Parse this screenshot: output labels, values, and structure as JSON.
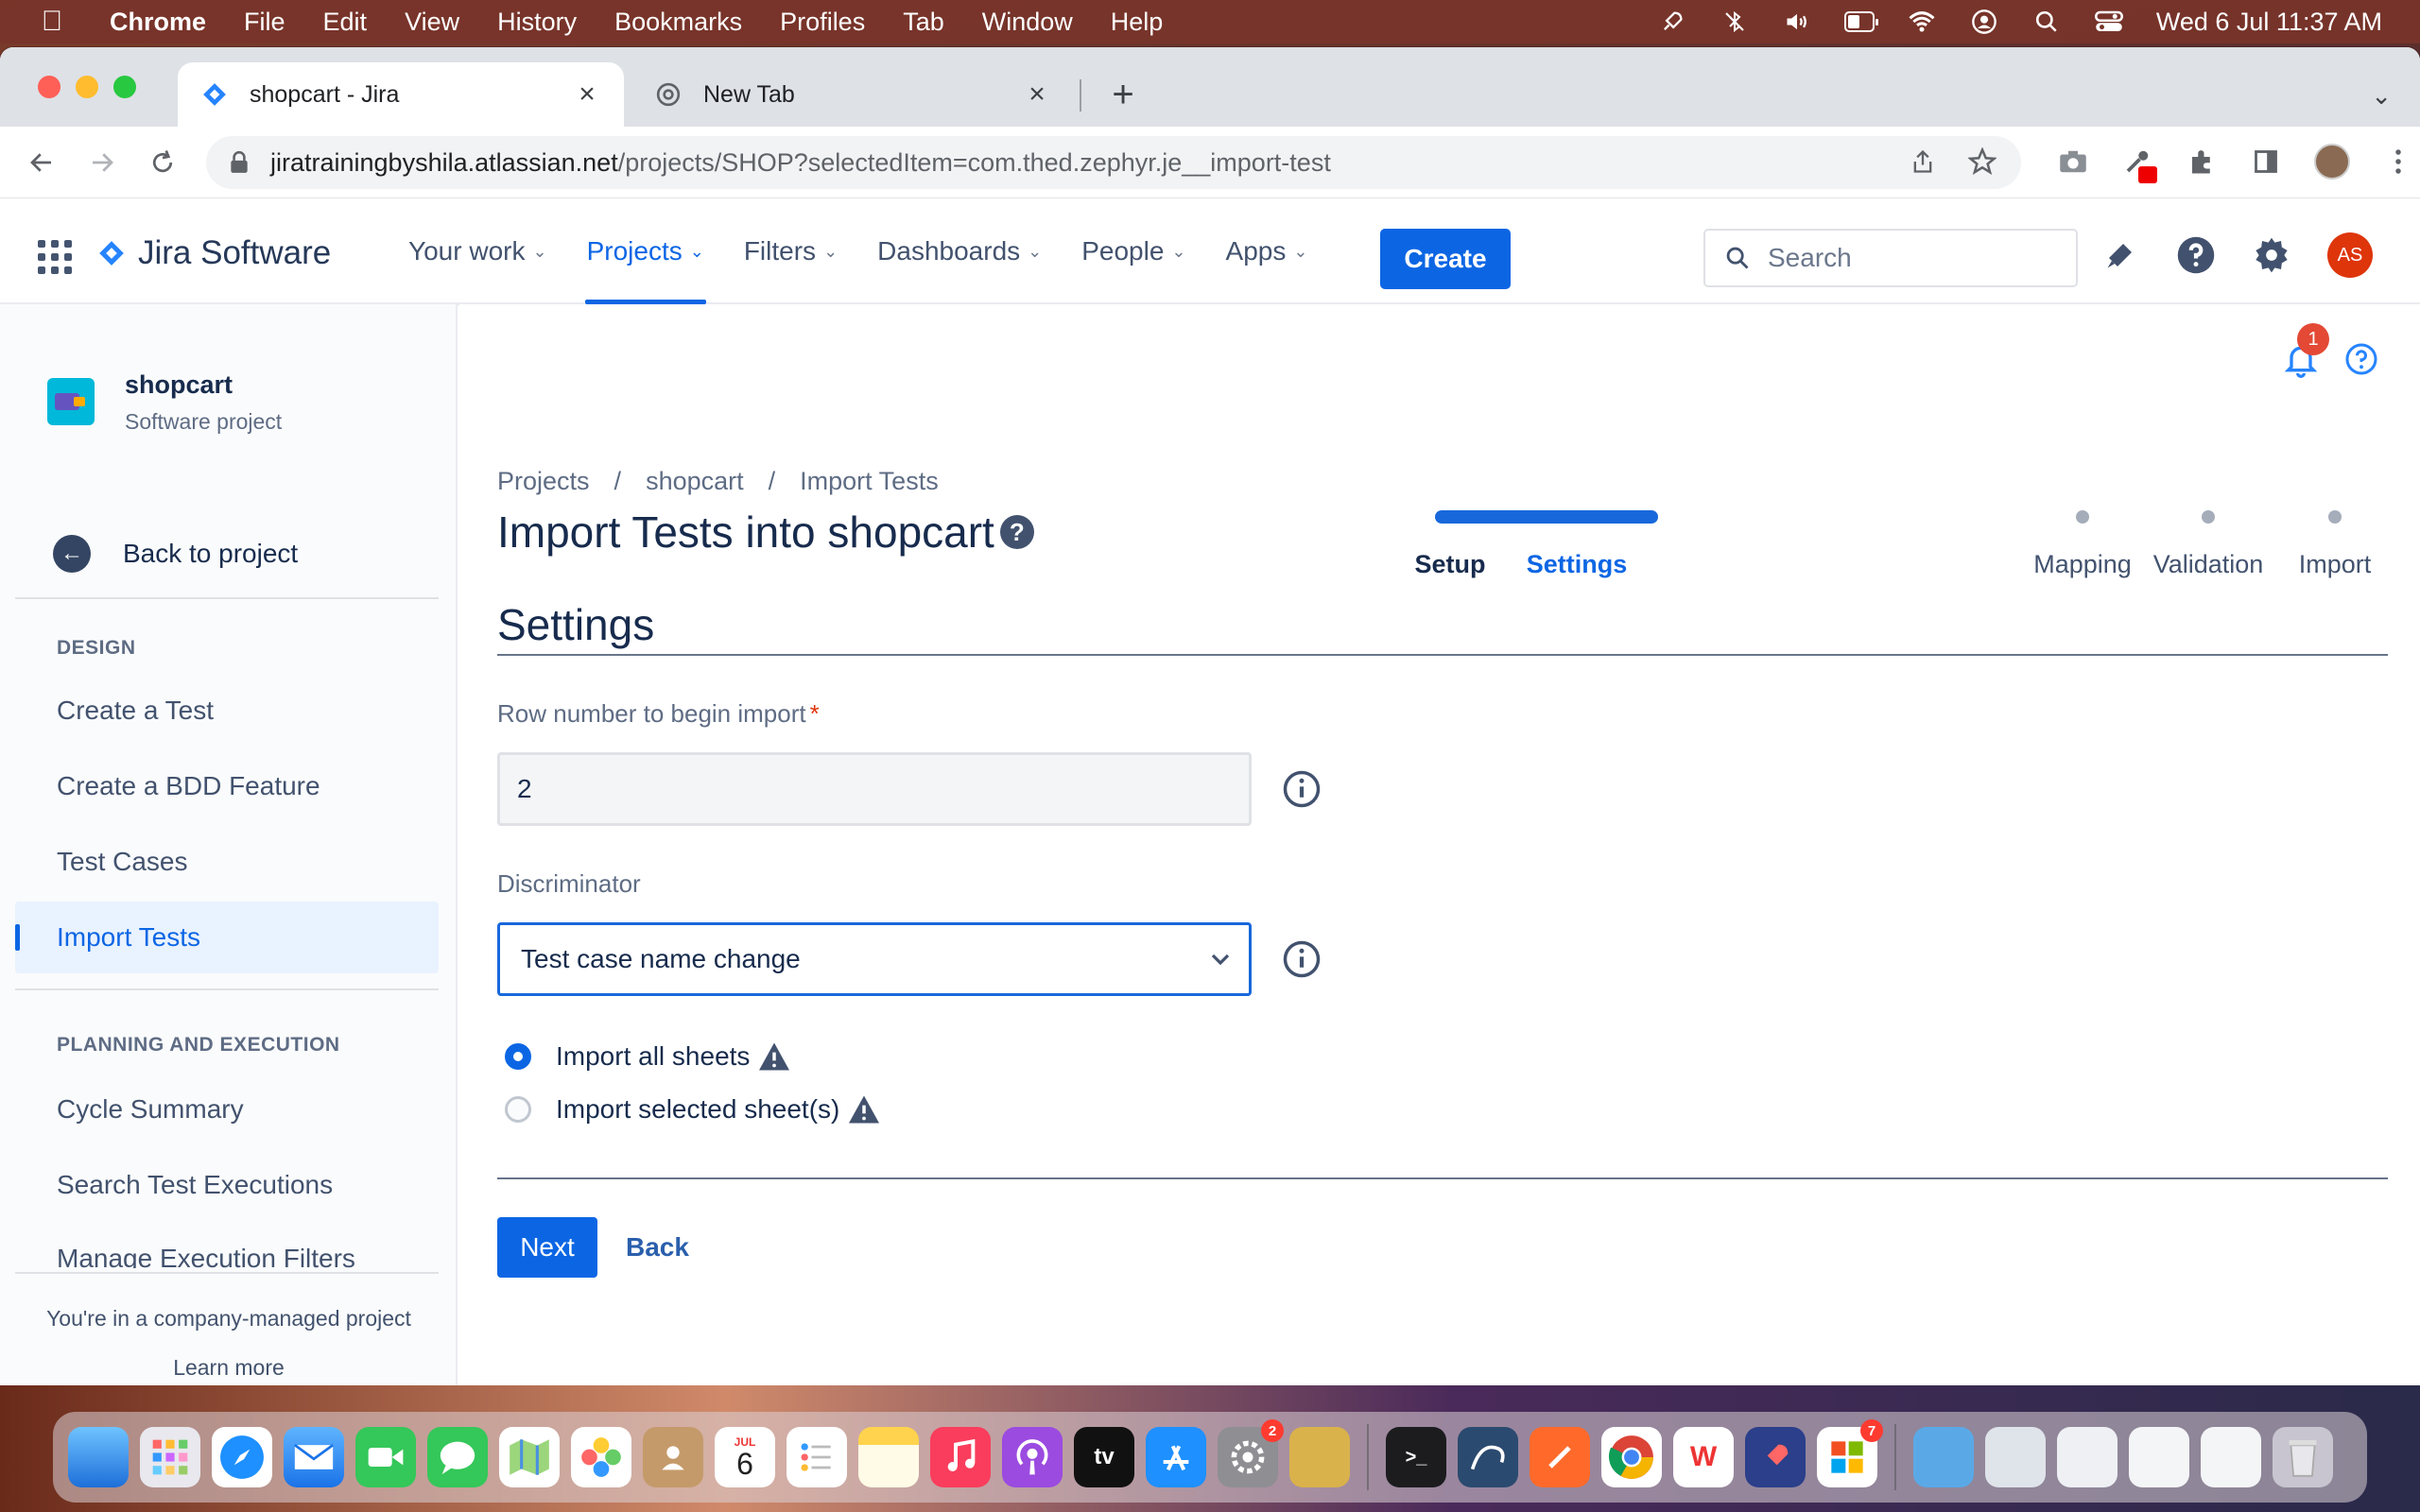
{
  "menubar": {
    "app_name": "Chrome",
    "items": [
      "File",
      "Edit",
      "View",
      "History",
      "Bookmarks",
      "Profiles",
      "Tab",
      "Window",
      "Help"
    ],
    "clock": "Wed 6 Jul  11:37 AM"
  },
  "browser": {
    "tabs": [
      {
        "title": "shopcart - Jira",
        "active": true
      },
      {
        "title": "New Tab",
        "active": false
      }
    ],
    "url_host": "jiratrainingbyshila.atlassian.net",
    "url_path": "/projects/SHOP?selectedItem=com.thed.zephyr.je__import-test"
  },
  "jira_nav": {
    "product_name": "Jira Software",
    "links": [
      {
        "label": "Your work",
        "active": false
      },
      {
        "label": "Projects",
        "active": true
      },
      {
        "label": "Filters",
        "active": false
      },
      {
        "label": "Dashboards",
        "active": false
      },
      {
        "label": "People",
        "active": false
      },
      {
        "label": "Apps",
        "active": false
      }
    ],
    "create_label": "Create",
    "search_placeholder": "Search",
    "user_initials": "AS"
  },
  "sidebar": {
    "project_name": "shopcart",
    "project_type": "Software project",
    "back_label": "Back to project",
    "design_heading": "DESIGN",
    "design_items": [
      {
        "label": "Create a Test",
        "active": false
      },
      {
        "label": "Create a BDD Feature",
        "active": false
      },
      {
        "label": "Test Cases",
        "active": false
      },
      {
        "label": "Import Tests",
        "active": true
      }
    ],
    "planning_heading": "PLANNING AND EXECUTION",
    "planning_items": [
      {
        "label": "Cycle Summary"
      },
      {
        "label": "Search Test Executions"
      },
      {
        "label": "Manage Execution Filters"
      }
    ],
    "footer_text": "You're in a company-managed project",
    "learn_more": "Learn more"
  },
  "main": {
    "notification_count": "1",
    "breadcrumbs": [
      "Projects",
      "shopcart",
      "Import Tests"
    ],
    "breadcrumb_sep": "/",
    "title": "Import Tests into shopcart",
    "steps": [
      {
        "label": "Setup",
        "state": "done"
      },
      {
        "label": "Settings",
        "state": "current"
      },
      {
        "label": "Mapping",
        "state": "pending"
      },
      {
        "label": "Validation",
        "state": "pending"
      },
      {
        "label": "Import",
        "state": "pending"
      }
    ],
    "section_title": "Settings",
    "row_label": "Row number to begin import",
    "row_required_mark": "*",
    "row_value": "2",
    "discriminator_label": "Discriminator",
    "discriminator_value": "Test case name change",
    "radio_options": [
      {
        "label": "Import all sheets",
        "checked": true
      },
      {
        "label": "Import selected sheet(s)",
        "checked": false
      }
    ],
    "next_label": "Next",
    "back_label": "Back"
  },
  "dock": {
    "calendar_month": "JUL",
    "calendar_day": "6",
    "badges": {
      "settings": "2",
      "office": "7"
    }
  },
  "colors": {
    "primary": "#0c66e4",
    "menubar": "#78342a",
    "text": "#172b4d"
  }
}
